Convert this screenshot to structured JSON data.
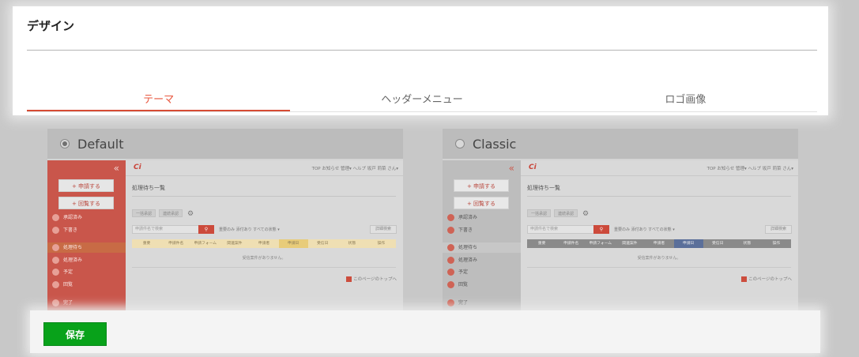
{
  "page": {
    "title": "デザイン"
  },
  "tabs": [
    {
      "label": "テーマ",
      "active": true
    },
    {
      "label": "ヘッダーメニュー",
      "active": false
    },
    {
      "label": "ロゴ画像",
      "active": false
    }
  ],
  "themes": [
    {
      "name": "Default",
      "selected": true,
      "preview": {
        "sidebar_color": "#c9564b",
        "sidebar_buttons": [
          "+ 申請する",
          "+ 回覧する"
        ],
        "sidebar_items": [
          "承認済み",
          "下書き",
          "処理待ち",
          "処理済み",
          "予定",
          "回覧",
          "完了"
        ],
        "logo": "Ci",
        "topnav": "TOP  お知らせ  管理▾  ヘルプ  坂戸 莉菜 さん▾",
        "page_title": "処理待ち一覧",
        "mini_buttons": [
          "一括承認",
          "連続承認"
        ],
        "search_placeholder": "申請件名で検索",
        "filters": "重要のみ  添付あり  すべての状態 ▾",
        "detail_button": "詳細検索",
        "table_headers": [
          "重要",
          "申請件名",
          "申請フォーム",
          "関連案件",
          "申請者",
          "申請日",
          "受信日",
          "状態",
          "操作"
        ],
        "empty_text": "受信案件がありません。",
        "page_top": "このページのトップへ",
        "header_color": "#efdfb3",
        "active_col_color": "#e8cc7a"
      }
    },
    {
      "name": "Classic",
      "selected": false,
      "preview": {
        "sidebar_color": "#bdbdbd",
        "sidebar_buttons": [
          "+ 申請する",
          "+ 回覧する"
        ],
        "sidebar_items": [
          "承認済み",
          "下書き",
          "処理待ち",
          "処理済み",
          "予定",
          "回覧",
          "完了"
        ],
        "logo": "Ci",
        "topnav": "TOP  お知らせ  管理▾  ヘルプ  坂戸 莉菜 さん▾",
        "page_title": "処理待ち一覧",
        "mini_buttons": [
          "一括承認",
          "連続承認"
        ],
        "search_placeholder": "申請件名で検索",
        "filters": "重要のみ  添付あり  すべての状態 ▾",
        "detail_button": "詳細検索",
        "table_headers": [
          "重要",
          "申請件名",
          "申請フォーム",
          "関連案件",
          "申請者",
          "申請日",
          "受信日",
          "状態",
          "操作"
        ],
        "empty_text": "受信案件がありません。",
        "page_top": "このページのトップへ",
        "header_color": "#8a8a8a",
        "active_col_color": "#5b6f9a"
      }
    }
  ],
  "footer": {
    "save_label": "保存"
  },
  "colors": {
    "accent": "#d64b33",
    "save": "#08a21a"
  }
}
